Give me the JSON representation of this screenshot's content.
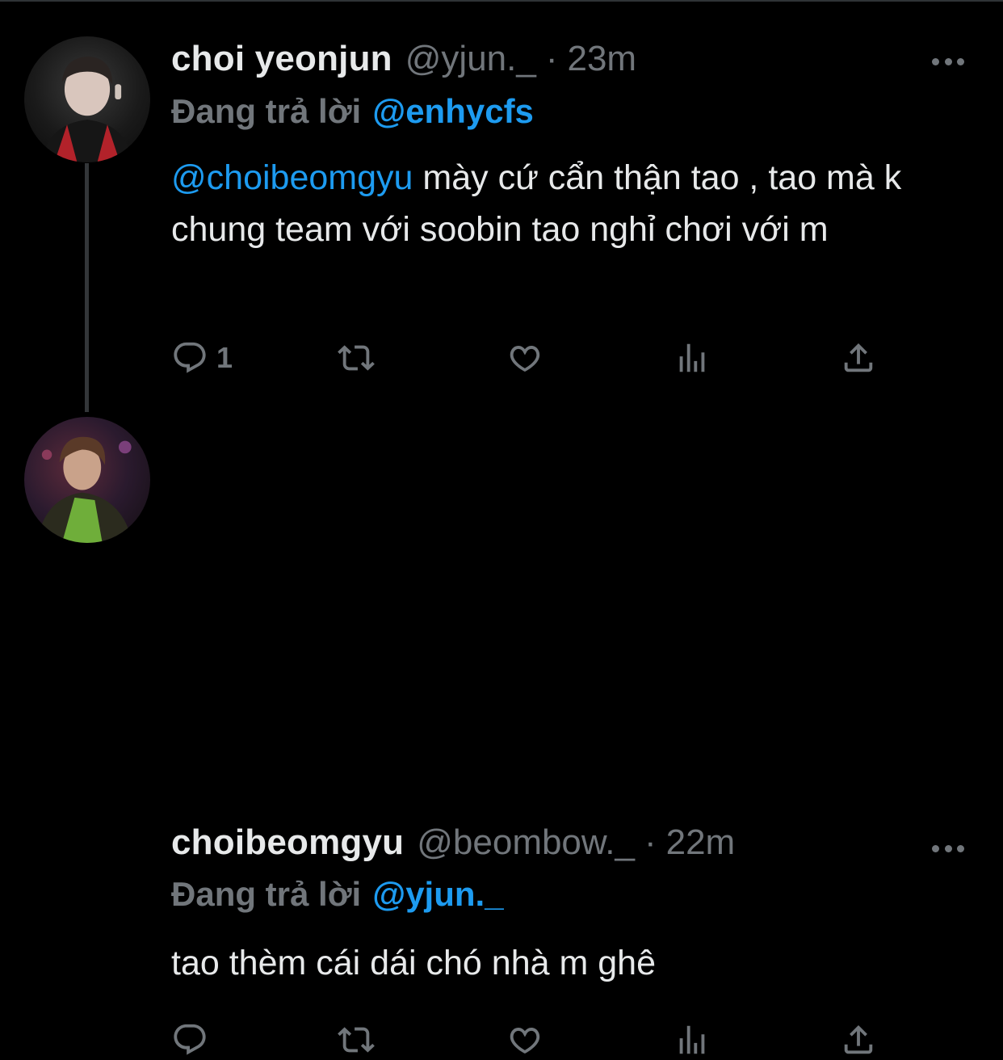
{
  "colors": {
    "background": "#000000",
    "text": "#e7e9ea",
    "muted": "#71767b",
    "link": "#1d9bf0",
    "thread_line": "#333639"
  },
  "tweets": [
    {
      "name": "choi yeonjun",
      "handle": "@yjun._",
      "separator": "·",
      "time": "23m",
      "reply_prefix": "Đang trả lời",
      "reply_handle": "@enhycfs",
      "mention": "@choibeomgyu",
      "text": " mày cứ cẩn thận tao , tao mà k chung team với soobin tao nghỉ chơi với m",
      "reply_count": "1",
      "icons": [
        "reply-icon",
        "retweet-icon",
        "like-icon",
        "views-icon",
        "share-icon"
      ]
    },
    {
      "name": "choibeomgyu",
      "handle": "@beombow._",
      "separator": "·",
      "time": "22m",
      "reply_prefix": "Đang trả lời",
      "reply_handle": "@yjun._",
      "text": "tao thèm cái dái chó nhà m ghê",
      "icons": [
        "reply-icon",
        "retweet-icon",
        "like-icon",
        "views-icon",
        "share-icon"
      ]
    }
  ]
}
